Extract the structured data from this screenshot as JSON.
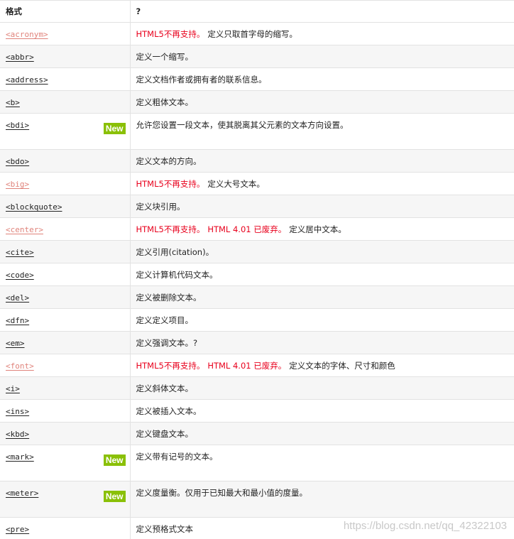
{
  "header": {
    "col_format": "格式",
    "col_desc": "?"
  },
  "rows": [
    {
      "tag": "<acronym>",
      "deprecated": true,
      "warn": [
        "HTML5不再支持。"
      ],
      "desc": "定义只取首字母的缩写。",
      "new": false
    },
    {
      "tag": "<abbr>",
      "deprecated": false,
      "warn": [],
      "desc": "定义一个缩写。",
      "new": false
    },
    {
      "tag": "<address>",
      "deprecated": false,
      "warn": [],
      "desc": "定义文档作者或拥有者的联系信息。",
      "new": false
    },
    {
      "tag": "<b>",
      "deprecated": false,
      "warn": [],
      "desc": "定义粗体文本。",
      "new": false
    },
    {
      "tag": "<bdi>",
      "deprecated": false,
      "warn": [],
      "desc": "允许您设置一段文本，使其脱离其父元素的文本方向设置。",
      "new": true
    },
    {
      "tag": "<bdo>",
      "deprecated": false,
      "warn": [],
      "desc": "定义文本的方向。",
      "new": false
    },
    {
      "tag": "<big>",
      "deprecated": true,
      "warn": [
        "HTML5不再支持。"
      ],
      "desc": "定义大号文本。",
      "new": false
    },
    {
      "tag": "<blockquote>",
      "deprecated": false,
      "warn": [],
      "desc": "定义块引用。",
      "new": false
    },
    {
      "tag": "<center>",
      "deprecated": true,
      "warn": [
        "HTML5不再支持。",
        "HTML 4.01 已废弃。"
      ],
      "desc": "定义居中文本。",
      "new": false
    },
    {
      "tag": "<cite>",
      "deprecated": false,
      "warn": [],
      "desc": "定义引用(citation)。",
      "new": false
    },
    {
      "tag": "<code>",
      "deprecated": false,
      "warn": [],
      "desc": "定义计算机代码文本。",
      "new": false
    },
    {
      "tag": "<del>",
      "deprecated": false,
      "warn": [],
      "desc": "定义被删除文本。",
      "new": false
    },
    {
      "tag": "<dfn>",
      "deprecated": false,
      "warn": [],
      "desc": "定义定义项目。",
      "new": false
    },
    {
      "tag": "<em>",
      "deprecated": false,
      "warn": [],
      "desc": "定义强调文本。?",
      "new": false
    },
    {
      "tag": "<font>",
      "deprecated": true,
      "warn": [
        "HTML5不再支持。",
        "HTML 4.01 已废弃。"
      ],
      "desc": "定义文本的字体、尺寸和颜色",
      "new": false
    },
    {
      "tag": "<i>",
      "deprecated": false,
      "warn": [],
      "desc": "定义斜体文本。",
      "new": false
    },
    {
      "tag": "<ins>",
      "deprecated": false,
      "warn": [],
      "desc": "定义被插入文本。",
      "new": false
    },
    {
      "tag": "<kbd>",
      "deprecated": false,
      "warn": [],
      "desc": "定义键盘文本。",
      "new": false
    },
    {
      "tag": "<mark>",
      "deprecated": false,
      "warn": [],
      "desc": "定义带有记号的文本。",
      "new": true
    },
    {
      "tag": "<meter>",
      "deprecated": false,
      "warn": [],
      "desc": "定义度量衡。仅用于已知最大和最小值的度量。",
      "new": true
    },
    {
      "tag": "<pre>",
      "deprecated": false,
      "warn": [],
      "desc": "定义预格式文本",
      "new": false
    }
  ],
  "new_badge_label": "New",
  "watermark": "https://blog.csdn.net/qq_42322103",
  "colors": {
    "warn": "#e8001c",
    "deprecated_link": "#e0837b",
    "new_badge": "#8ac007"
  }
}
